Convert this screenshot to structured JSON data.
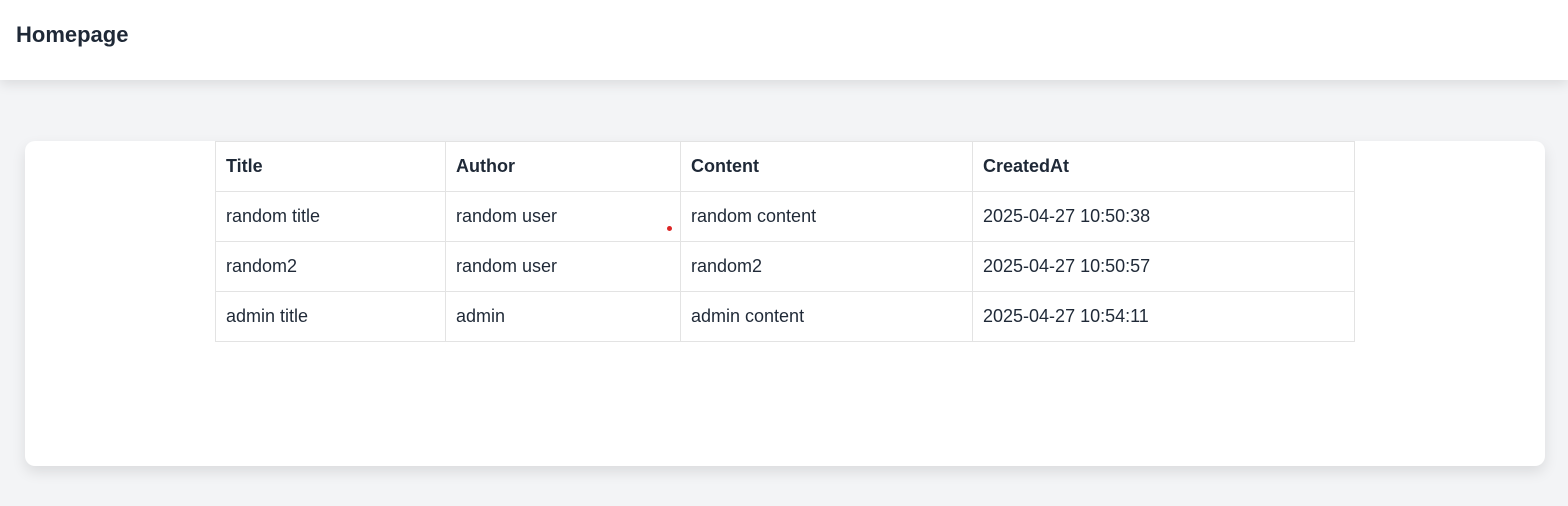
{
  "header": {
    "title": "Homepage"
  },
  "table": {
    "columns": [
      "Title",
      "Author",
      "Content",
      "CreatedAt"
    ],
    "rows": [
      {
        "title": "random title",
        "author": "random user",
        "content": "random content",
        "created_at": "2025-04-27 10:50:38"
      },
      {
        "title": "random2",
        "author": "random user",
        "content": "random2",
        "created_at": "2025-04-27 10:50:57"
      },
      {
        "title": "admin title",
        "author": "admin",
        "content": "admin content",
        "created_at": "2025-04-27 10:54:11"
      }
    ]
  },
  "colors": {
    "background": "#f3f4f6",
    "surface": "#ffffff",
    "text": "#1f2937",
    "border": "#e3e3e3",
    "marker": "#dc2626"
  }
}
